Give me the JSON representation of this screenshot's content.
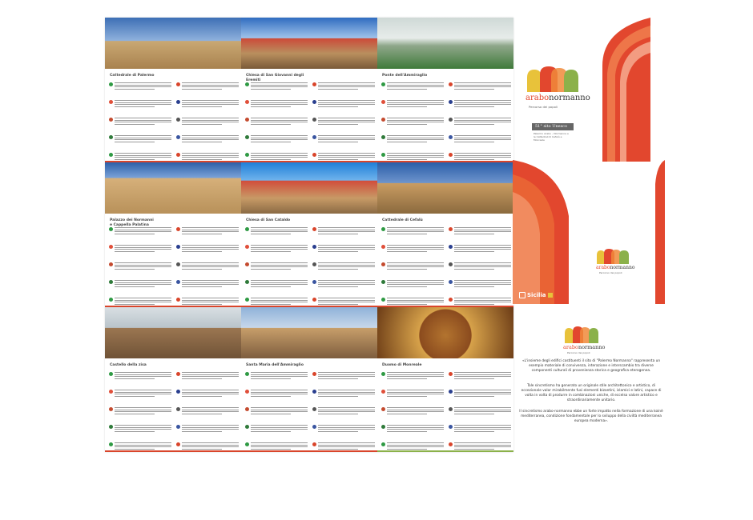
{
  "brochure": {
    "panels": [
      {
        "title": "Cattedrale di Palermo"
      },
      {
        "title": "Chiesa di San Giovanni degli Eremiti"
      },
      {
        "title": "Ponte dell'Ammiraglio"
      },
      {
        "title": "Palazzo dei Normanni\ne Cappella Palatina"
      },
      {
        "title": "Chiesa di San Cataldo"
      },
      {
        "title": "Cattedrale di Cefalù"
      },
      {
        "title": "Castello della zisa"
      },
      {
        "title": "Santa Maria dell'Ammiraglio"
      },
      {
        "title": "Duomo di Monreale"
      }
    ]
  },
  "cover": {
    "brand_part1": "arabo",
    "brand_part2": "normanno",
    "tagline": "Percorso dei popoli",
    "unesco_label": "51° sito Unesco",
    "unesco_sub": "Palermo Arabo – Normanna e le Cattedrali di Cefalù e Monreale"
  },
  "sicilia": {
    "label": "Sicilia"
  },
  "small_logo": {
    "brand_part1": "arabo",
    "brand_part2": "normanno",
    "tagline": "Percorso dei popoli"
  },
  "back_logo": {
    "brand_part1": "arabo",
    "brand_part2": "normanno",
    "tagline": "Percorso dei popoli"
  },
  "back_text": {
    "p1": "«L'insieme degli edifici costituenti il sito di \"Palermo Normanna\" rappresenta un esempio materiale di convivenza, interazione e interscambio tra diverse componenti culturali di provenienza storica e geografica eterogenea.",
    "p2": "Tale sincretismo ha generato un originale stile architettonico e artistico, di eccezionale valor mirabilmente fusi elementi bizantini, islamici e latini, capace di volta in volta di produrre in combinazioni uniche, di eccelso valore artistico e straordinariamente unitario.",
    "p3": "Il sincretismo arabo-normanno ebbe un forte impatto nella formazione di una koinè mediterranea, condizione fondamentale per lo sviluppo della civiltà mediterranea europea moderna»."
  },
  "colors": {
    "red": "#d9452b",
    "orange": "#f08a3a",
    "green": "#8bb14a",
    "yellow": "#e8c23a"
  }
}
